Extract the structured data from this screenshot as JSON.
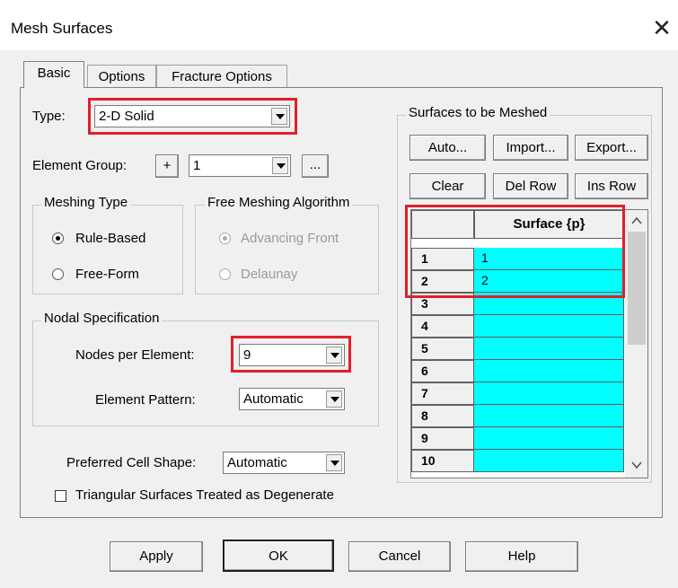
{
  "window": {
    "title": "Mesh Surfaces",
    "close_icon": "close-icon"
  },
  "tabs": [
    {
      "label": "Basic",
      "active": true
    },
    {
      "label": "Options",
      "active": false
    },
    {
      "label": "Fracture Options",
      "active": false
    }
  ],
  "type": {
    "label": "Type:",
    "value": "2-D Solid"
  },
  "element_group": {
    "label": "Element Group:",
    "plus": "+",
    "value": "1",
    "ellipsis": "..."
  },
  "meshing_type": {
    "title": "Meshing Type",
    "options": [
      {
        "label": "Rule-Based",
        "selected": true
      },
      {
        "label": "Free-Form",
        "selected": false
      }
    ]
  },
  "free_meshing": {
    "title": "Free Meshing Algorithm",
    "options": [
      {
        "label": "Advancing Front",
        "selected": true
      },
      {
        "label": "Delaunay",
        "selected": false
      }
    ]
  },
  "nodal": {
    "title": "Nodal Specification",
    "nodes_label": "Nodes per Element:",
    "nodes_value": "9",
    "pattern_label": "Element Pattern:",
    "pattern_value": "Automatic"
  },
  "cell_shape": {
    "label": "Preferred Cell Shape:",
    "value": "Automatic"
  },
  "degenerate": {
    "label": "Triangular Surfaces Treated as Degenerate",
    "checked": false
  },
  "surfaces": {
    "title": "Surfaces to be Meshed",
    "buttons": {
      "auto": "Auto...",
      "import": "Import...",
      "export": "Export...",
      "clear": "Clear",
      "del_row": "Del Row",
      "ins_row": "Ins Row"
    },
    "column_header": "Surface {p}",
    "rows": [
      {
        "num": "1",
        "value": "1"
      },
      {
        "num": "2",
        "value": "2"
      },
      {
        "num": "3",
        "value": ""
      },
      {
        "num": "4",
        "value": ""
      },
      {
        "num": "5",
        "value": ""
      },
      {
        "num": "6",
        "value": ""
      },
      {
        "num": "7",
        "value": ""
      },
      {
        "num": "8",
        "value": ""
      },
      {
        "num": "9",
        "value": ""
      },
      {
        "num": "10",
        "value": ""
      }
    ]
  },
  "footer": {
    "apply": "Apply",
    "ok": "OK",
    "cancel": "Cancel",
    "help": "Help"
  },
  "colors": {
    "highlight": "#e0202a",
    "cell_fill": "#00ffff"
  }
}
